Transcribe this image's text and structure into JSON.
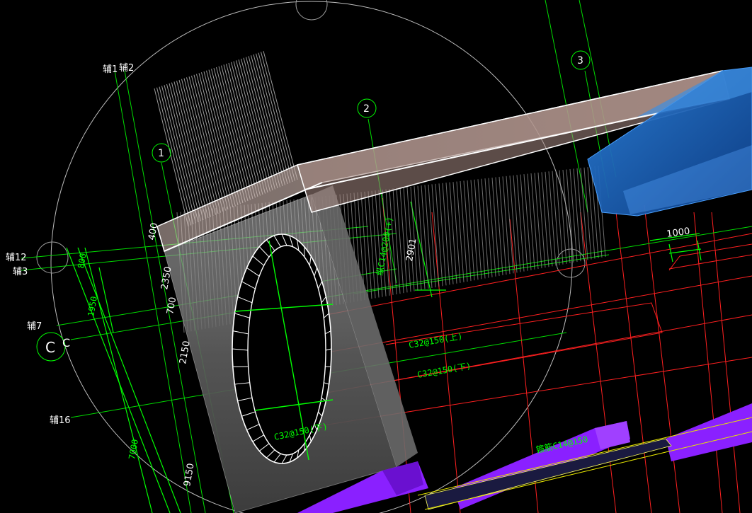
{
  "axis_labels": {
    "aux1": "辅1",
    "aux2": "辅2",
    "aux12": "辅12",
    "aux3": "辅3",
    "aux7": "辅7",
    "aux16": "辅16",
    "c_left": "C",
    "c_small": "C",
    "n1": "1",
    "n2": "2",
    "n3": "3"
  },
  "dimensions": {
    "d400": "400",
    "d800": "800",
    "d1950": "1950",
    "d2350": "2350",
    "d700": "700",
    "d2150": "2150",
    "d7000": "7000",
    "d9150": "9150",
    "d1000": "1000",
    "d2901": "2901"
  },
  "rebar_labels": {
    "c320_upper": "C32@150(上)",
    "c320_lower": "C32@150(下)",
    "vertical_tag": "纵C14@200(+)",
    "hole_tag": "C32@150(下)",
    "purple_beam_tag": "箍筋C14@150"
  },
  "colors": {
    "background": "#000000",
    "axis_green": "#00ff00",
    "rebar_red": "#ff2020",
    "slab_fill": "#c9a89f",
    "wall_fill": "#8a8a8a",
    "blue_block": "#1e6fc8",
    "purple_beam": "#8a20ff",
    "wire_white": "#ffffff"
  }
}
